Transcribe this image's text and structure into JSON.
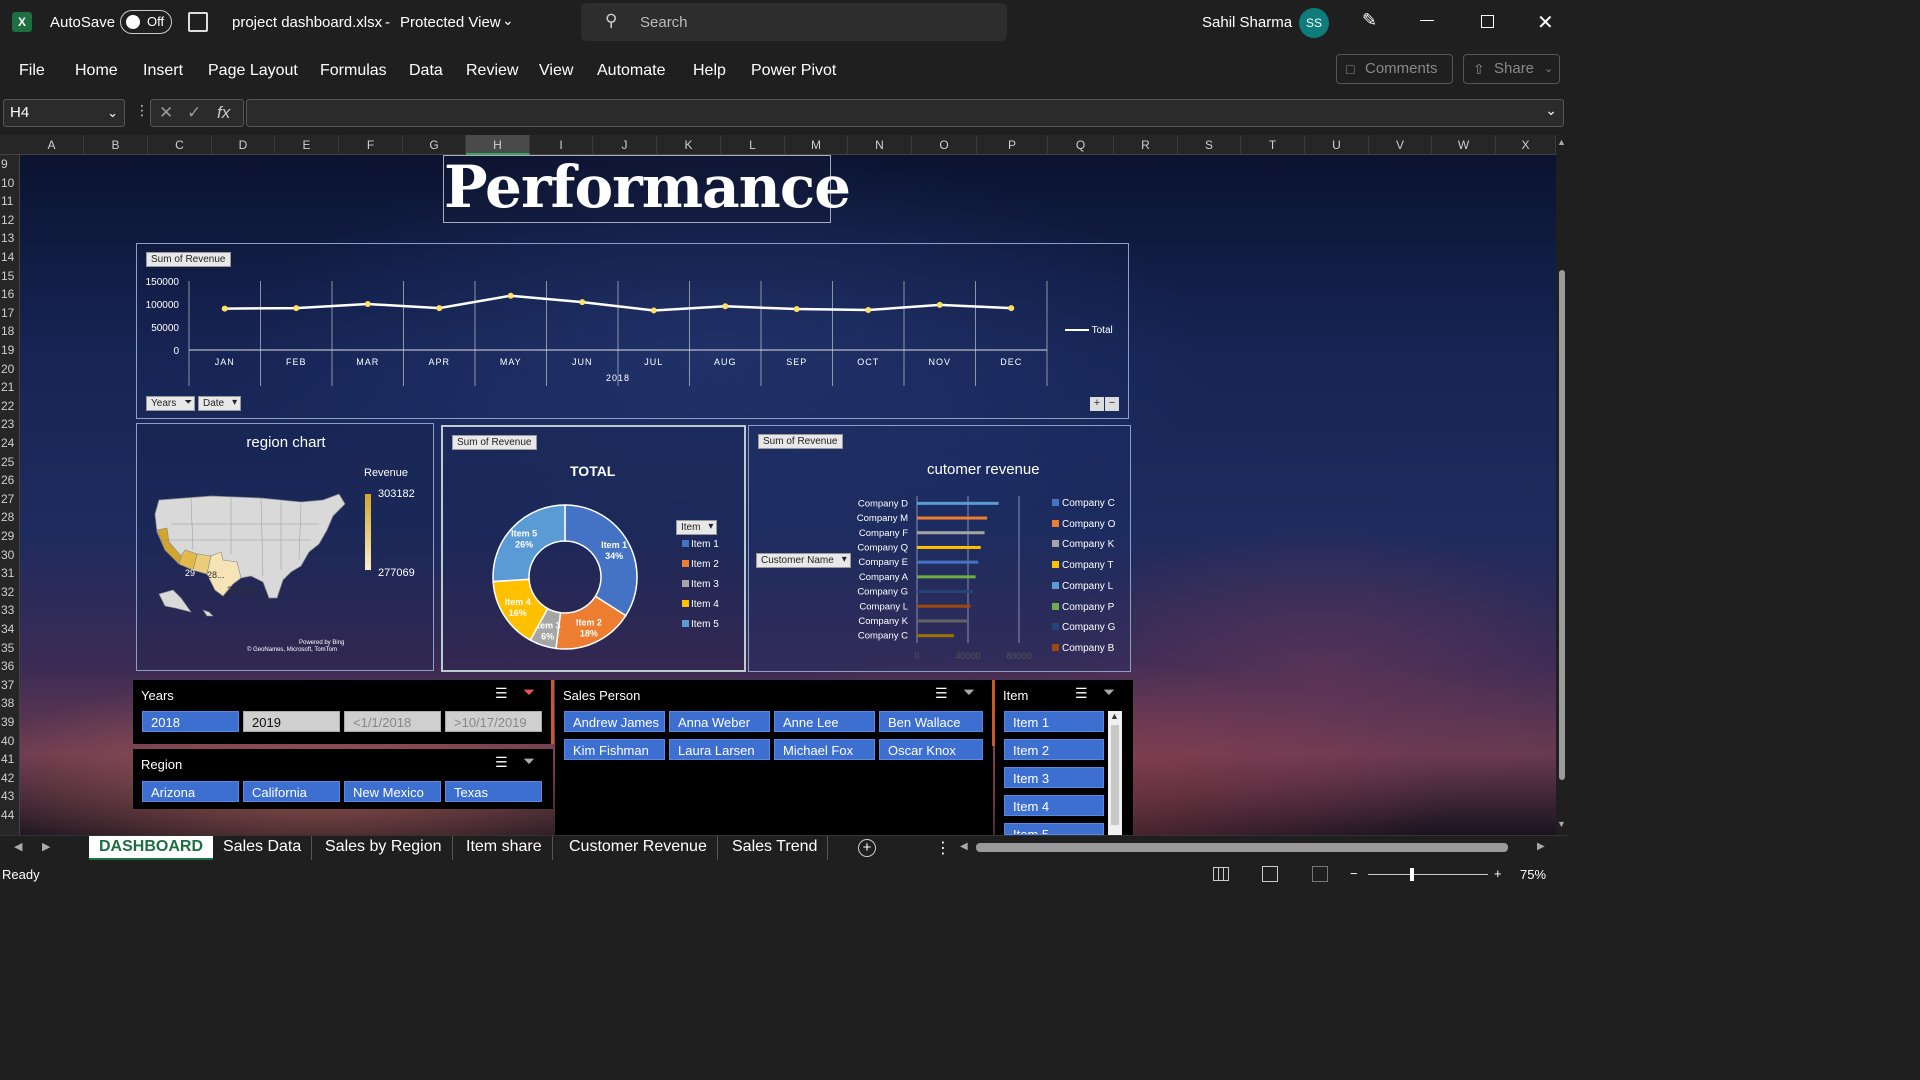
{
  "window": {
    "app": "AutoSave",
    "autosave_state": "Off",
    "file": "project dashboard.xlsx",
    "mode": "Protected View",
    "search_placeholder": "Search",
    "user": "Sahil Sharma",
    "initials": "SS"
  },
  "menu": [
    "File",
    "Home",
    "Insert",
    "Page Layout",
    "Formulas",
    "Data",
    "Review",
    "View",
    "Automate",
    "Help",
    "Power Pivot"
  ],
  "ribbon_right": {
    "comments": "Comments",
    "share": "Share"
  },
  "formula_bar": {
    "name_box": "H4",
    "fx": "fx",
    "value": ""
  },
  "columns": [
    "A",
    "B",
    "C",
    "D",
    "E",
    "F",
    "G",
    "H",
    "I",
    "J",
    "K",
    "L",
    "M",
    "N",
    "O",
    "P",
    "Q",
    "R",
    "S",
    "T",
    "U",
    "V",
    "W",
    "X"
  ],
  "rows": [
    "9",
    "10",
    "11",
    "12",
    "13",
    "14",
    "15",
    "16",
    "17",
    "18",
    "19",
    "20",
    "21",
    "22",
    "23",
    "24",
    "25",
    "26",
    "27",
    "28",
    "29",
    "30",
    "31",
    "32",
    "33",
    "34",
    "35",
    "36",
    "37",
    "38",
    "39",
    "40",
    "41",
    "42",
    "43",
    "44"
  ],
  "title": "Performance",
  "line_chart": {
    "badge": "Sum of Revenue",
    "filter1": "Years",
    "filter2": "Date",
    "year_label": "2018",
    "legend": "Total",
    "chart_data": {
      "type": "line",
      "categories": [
        "JAN",
        "FEB",
        "MAR",
        "APR",
        "MAY",
        "JUN",
        "JUL",
        "AUG",
        "SEP",
        "OCT",
        "NOV",
        "DEC"
      ],
      "series": [
        {
          "name": "Total",
          "values": [
            90000,
            91000,
            100000,
            91000,
            118000,
            104000,
            86000,
            95000,
            89000,
            87000,
            98000,
            91000
          ]
        }
      ],
      "ylim": [
        0,
        150000
      ],
      "yticks": [
        "150000",
        "100000",
        "50000",
        "0"
      ]
    }
  },
  "map_chart": {
    "title": "region chart",
    "legend_title": "Revenue",
    "max": "303182",
    "min": "277069",
    "labels": [
      "29",
      "28...",
      "277069"
    ],
    "powered": "Powered by Bing",
    "credit": "© GeoNames, Microsoft, TomTom"
  },
  "donut_chart": {
    "badge": "Sum of Revenue",
    "title": "TOTAL",
    "filter": "Item",
    "chart_data": {
      "type": "pie",
      "categories": [
        "Item 1",
        "Item 2",
        "Item 3",
        "Item 4",
        "Item 5"
      ],
      "values": [
        34,
        18,
        6,
        16,
        26
      ],
      "labels": [
        "Item 1\n34%",
        "Item 2\n18%",
        "Item 3\n6%",
        "Item 4\n16%",
        "Item 5\n26%"
      ]
    },
    "colors": [
      "#4472c4",
      "#ed7d31",
      "#a5a5a5",
      "#ffc000",
      "#5b9bd5"
    ],
    "legend": [
      "Item 1",
      "Item 2",
      "Item 3",
      "Item 4",
      "Item 5"
    ]
  },
  "bar_chart": {
    "badge": "Sum of Revenue",
    "title": "cutomer revenue",
    "filter": "Customer Name",
    "chart_data": {
      "type": "bar",
      "categories": [
        "Company D",
        "Company M",
        "Company F",
        "Company Q",
        "Company E",
        "Company A",
        "Company G",
        "Company L",
        "Company K",
        "Company C"
      ],
      "values": [
        64000,
        55000,
        53000,
        50000,
        48000,
        46000,
        44000,
        42000,
        40000,
        29000
      ],
      "xlim": [
        0,
        80000
      ],
      "xticks": [
        "0",
        "40000",
        "80000"
      ]
    },
    "colors": [
      "#5b9bd5",
      "#ed7d31",
      "#a5a5a5",
      "#ffc000",
      "#4472c4",
      "#70ad47",
      "#264478",
      "#9e480e",
      "#636363",
      "#997300"
    ],
    "legend": [
      "Company C",
      "Company O",
      "Company K",
      "Company T",
      "Company L",
      "Company P",
      "Company G",
      "Company B"
    ],
    "legend_colors": [
      "#4472c4",
      "#ed7d31",
      "#a5a5a5",
      "#ffc000",
      "#5b9bd5",
      "#70ad47",
      "#264478",
      "#9e480e"
    ]
  },
  "slicers": {
    "years": {
      "title": "Years",
      "items": [
        "2018",
        "2019",
        "<1/1/2018",
        ">10/17/2019"
      ]
    },
    "region": {
      "title": "Region",
      "items": [
        "Arizona",
        "California",
        "New Mexico",
        "Texas"
      ]
    },
    "sales_person": {
      "title": "Sales Person",
      "items": [
        "Andrew James",
        "Anna Weber",
        "Anne Lee",
        "Ben Wallace",
        "Kim Fishman",
        "Laura Larsen",
        "Michael Fox",
        "Oscar Knox"
      ]
    },
    "item": {
      "title": "Item",
      "items": [
        "Item 1",
        "Item 2",
        "Item 3",
        "Item 4",
        "Item 5"
      ]
    }
  },
  "tabs": [
    "DASHBOARD",
    "Sales Data",
    "Sales by Region",
    "Item share",
    "Customer Revenue",
    "Sales Trend"
  ],
  "status": {
    "ready": "Ready",
    "zoom": "75%"
  }
}
